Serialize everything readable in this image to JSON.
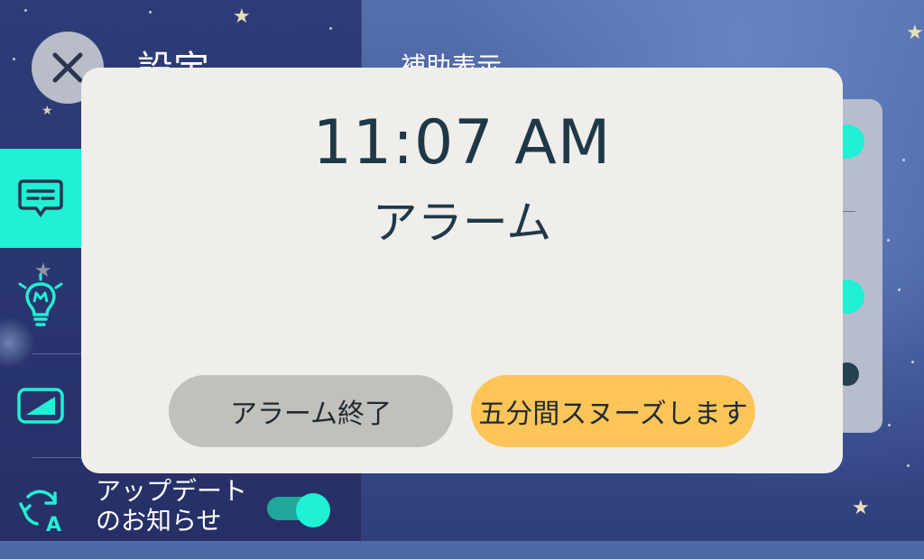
{
  "header": {
    "title": "設定",
    "section_title": "補助表示"
  },
  "sidebar": {
    "items": [
      {
        "name": "caption",
        "icon": "speech-bubble-icon",
        "active": true
      },
      {
        "name": "bulb",
        "icon": "lightbulb-icon",
        "active": false
      },
      {
        "name": "display",
        "icon": "screen-icon",
        "active": false
      },
      {
        "name": "update",
        "icon": "auto-update-icon",
        "active": false
      }
    ]
  },
  "update_setting": {
    "label_line1": "アップデート",
    "label_line2": "のお知らせ",
    "enabled": true
  },
  "alarm": {
    "time": "11:07 AM",
    "label": "アラーム",
    "stop_label": "アラーム終了",
    "snooze_label": "五分間スヌーズします"
  },
  "colors": {
    "accent": "#20f0d4",
    "snooze": "#fdc458",
    "stop": "#c2c0bb",
    "modal_bg": "#efeeea",
    "text_dark": "#1f3848"
  }
}
